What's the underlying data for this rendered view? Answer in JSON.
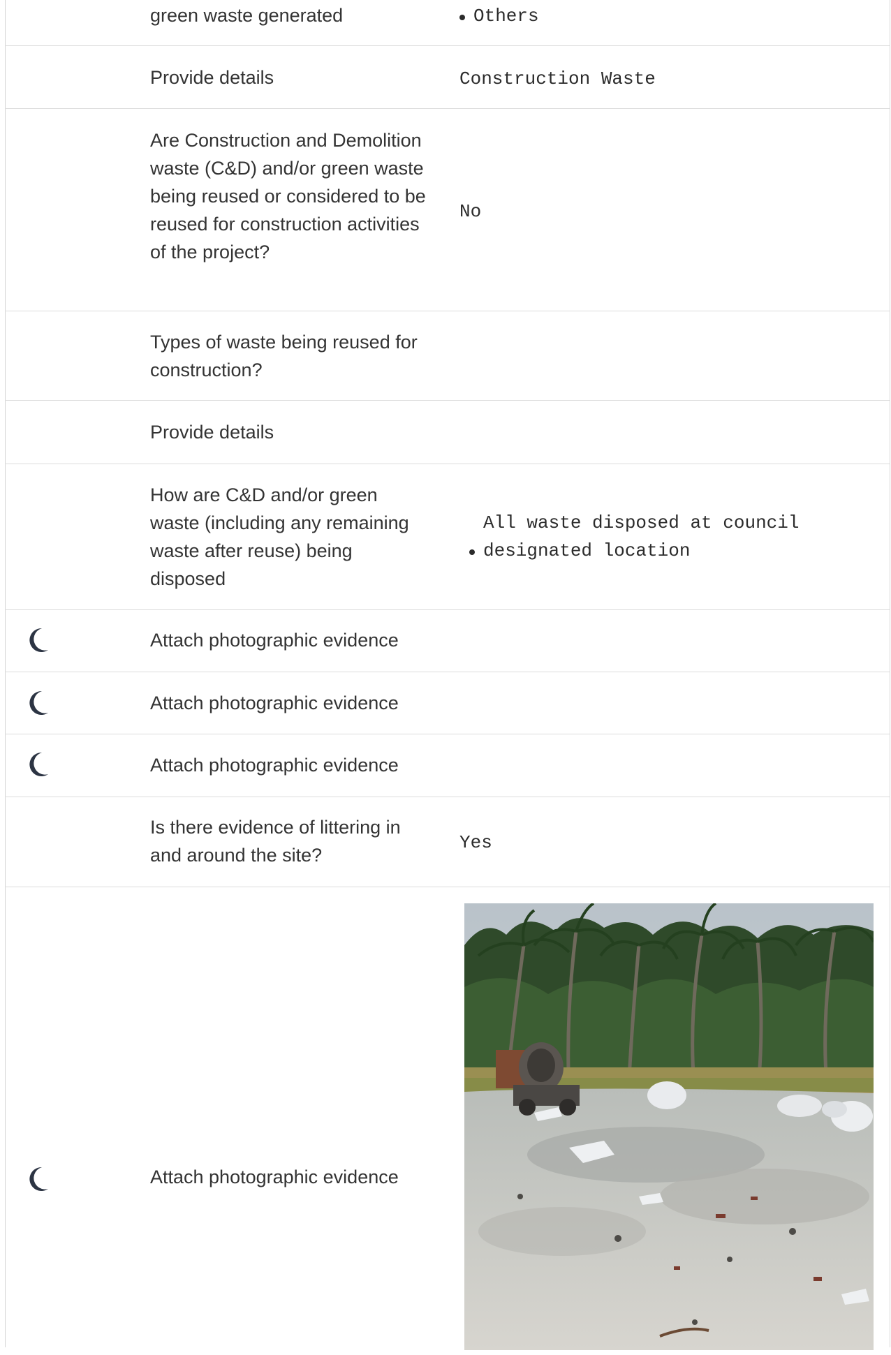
{
  "rows": [
    {
      "question": "green waste generated",
      "answer": "Others"
    },
    {
      "question": "Provide details",
      "answer": "Construction Waste"
    },
    {
      "question": "Are Construction and Demolition waste (C&D) and/or green waste being reused or considered to be reused for construction activities of the project?",
      "answer": "No"
    },
    {
      "question": "Types of waste being reused for construction?",
      "answer": ""
    },
    {
      "question": "Provide details",
      "answer": ""
    },
    {
      "question": "How are C&D and/or green waste (including any remaining waste after reuse) being disposed",
      "answer": "All waste disposed at council designated location"
    },
    {
      "question": "Attach photographic evidence",
      "answer": ""
    },
    {
      "question": "Attach photographic evidence",
      "answer": ""
    },
    {
      "question": "Attach photographic evidence",
      "answer": ""
    },
    {
      "question": "Is there evidence of littering in and around the site?",
      "answer": "Yes"
    },
    {
      "question": "Attach photographic evidence",
      "answer": ""
    }
  ],
  "icons": {
    "status": "moon-icon",
    "photo": "site-photo-image"
  },
  "colors": {
    "border": "#dcdcdc",
    "question_text": "#333333",
    "answer_text": "#2b2b2b",
    "icon": "#2c3443"
  }
}
